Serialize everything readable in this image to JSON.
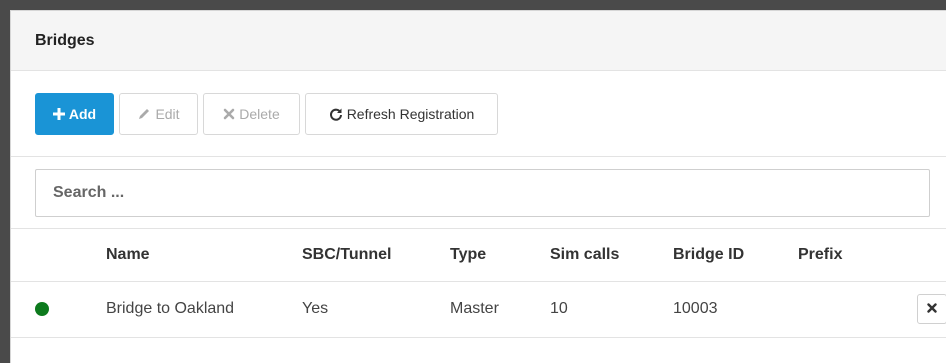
{
  "panel": {
    "title": "Bridges"
  },
  "toolbar": {
    "add_label": "Add",
    "edit_label": "Edit",
    "delete_label": "Delete",
    "refresh_label": "Refresh Registration"
  },
  "search": {
    "placeholder": "Search ...",
    "value": ""
  },
  "table": {
    "headers": [
      "Name",
      "SBC/Tunnel",
      "Type",
      "Sim calls",
      "Bridge ID",
      "Prefix"
    ],
    "rows": [
      {
        "status_color": "#0d7a1d",
        "name": "Bridge to Oakland",
        "sbc_tunnel": "Yes",
        "type": "Master",
        "sim_calls": "10",
        "bridge_id": "10003",
        "prefix": ""
      }
    ]
  },
  "icons": {
    "add": "plus-icon",
    "edit": "pencil-icon",
    "delete": "times-icon",
    "refresh": "refresh-icon",
    "remove": "close-icon"
  },
  "colors": {
    "primary": "#1a94d6",
    "status_online": "#0d7a1d"
  }
}
